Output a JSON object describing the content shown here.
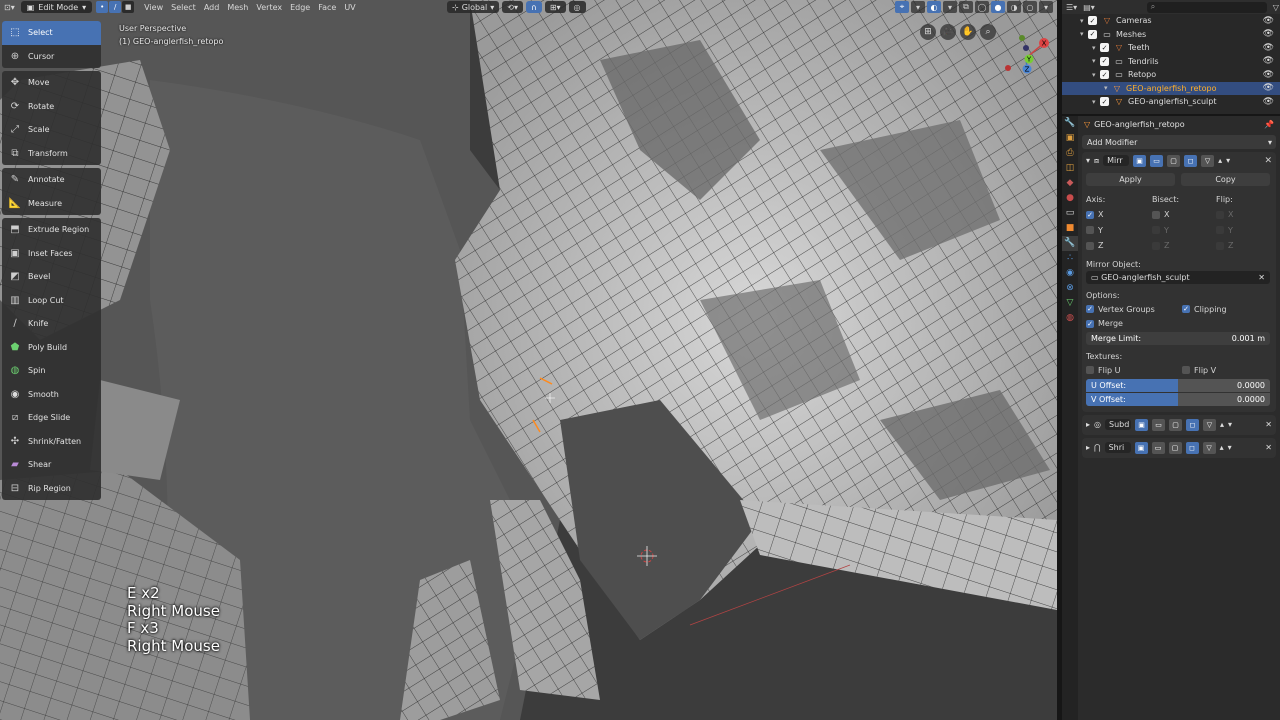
{
  "header": {
    "mode": "Edit Mode",
    "menus": [
      "View",
      "Select",
      "Add",
      "Mesh",
      "Vertex",
      "Edge",
      "Face",
      "UV"
    ],
    "orientation": "Global"
  },
  "viewport": {
    "perspective": "User Perspective",
    "object": "(1) GEO-anglerfish_retopo"
  },
  "toolbar": {
    "groups": [
      [
        {
          "label": "Select",
          "icon": "select-box-icon",
          "active": true
        },
        {
          "label": "Cursor",
          "icon": "cursor-icon"
        }
      ],
      [
        {
          "label": "Move",
          "icon": "move-icon"
        },
        {
          "label": "Rotate",
          "icon": "rotate-icon"
        },
        {
          "label": "Scale",
          "icon": "scale-icon"
        },
        {
          "label": "Transform",
          "icon": "transform-icon"
        }
      ],
      [
        {
          "label": "Annotate",
          "icon": "annotate-icon"
        },
        {
          "label": "Measure",
          "icon": "measure-icon"
        }
      ],
      [
        {
          "label": "Extrude Region",
          "icon": "extrude-icon"
        },
        {
          "label": "Inset Faces",
          "icon": "inset-icon"
        },
        {
          "label": "Bevel",
          "icon": "bevel-icon"
        },
        {
          "label": "Loop Cut",
          "icon": "loop-cut-icon"
        },
        {
          "label": "Knife",
          "icon": "knife-icon"
        },
        {
          "label": "Poly Build",
          "icon": "poly-build-icon"
        },
        {
          "label": "Spin",
          "icon": "spin-icon"
        },
        {
          "label": "Smooth",
          "icon": "smooth-icon"
        },
        {
          "label": "Edge Slide",
          "icon": "edge-slide-icon"
        },
        {
          "label": "Shrink/Fatten",
          "icon": "shrink-fatten-icon"
        },
        {
          "label": "Shear",
          "icon": "shear-icon"
        },
        {
          "label": "Rip Region",
          "icon": "rip-icon"
        }
      ]
    ]
  },
  "keys": [
    "E x2",
    "Right Mouse",
    "F x3",
    "Right Mouse"
  ],
  "gizmo": {
    "x": "X",
    "y": "Y",
    "z": "Z"
  },
  "outliner": {
    "search_placeholder": "",
    "rows": [
      {
        "label": "Cameras",
        "indent": 1,
        "icon_color": "#e07a3a"
      },
      {
        "label": "Meshes",
        "indent": 1
      },
      {
        "label": "Teeth",
        "indent": 2,
        "icon_color": "#e07a3a"
      },
      {
        "label": "Tendrils",
        "indent": 2
      },
      {
        "label": "Retopo",
        "indent": 2
      },
      {
        "label": "GEO-anglerfish_retopo",
        "indent": 3,
        "icon_color": "#ff9a3a",
        "selected": true
      },
      {
        "label": "GEO-anglerfish_sculpt",
        "indent": 2,
        "icon_color": "#ff9a3a"
      }
    ]
  },
  "properties": {
    "object_name": "GEO-anglerfish_retopo",
    "add_modifier": "Add Modifier",
    "mirror": {
      "name": "Mirr",
      "apply": "Apply",
      "copy": "Copy",
      "axis_label": "Axis:",
      "bisect_label": "Bisect:",
      "flip_label": "Flip:",
      "axes": [
        "X",
        "Y",
        "Z"
      ],
      "mirror_object_label": "Mirror Object:",
      "mirror_object": "GEO-anglerfish_sculpt",
      "options_label": "Options:",
      "vertex_groups": "Vertex Groups",
      "clipping": "Clipping",
      "merge": "Merge",
      "merge_limit_label": "Merge Limit:",
      "merge_limit": "0.001 m",
      "textures_label": "Textures:",
      "flip_u": "Flip U",
      "flip_v": "Flip V",
      "u_offset_label": "U Offset:",
      "u_offset": "0.0000",
      "v_offset_label": "V Offset:",
      "v_offset": "0.0000"
    },
    "subd": "Subd",
    "shri": "Shri"
  },
  "colors": {
    "accent": "#4772b3",
    "active_object": "#ffaf29"
  }
}
